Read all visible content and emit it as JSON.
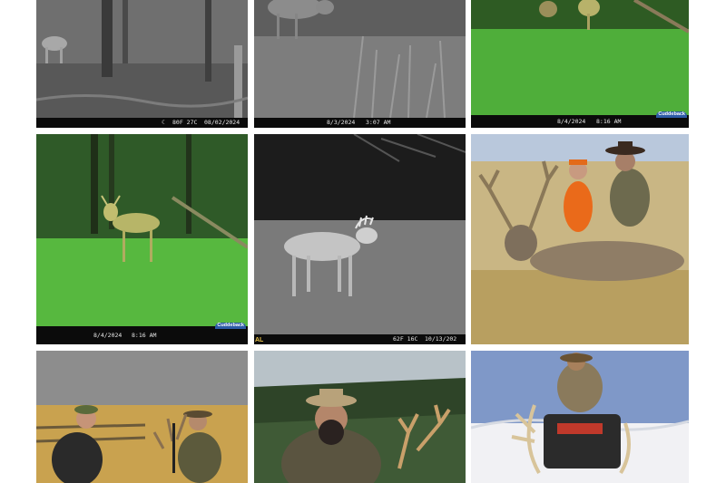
{
  "grid": {
    "tiles": [
      {
        "kind": "trail-cam-night",
        "caption": {
          "temp": "80F 27C",
          "date": "08/02/2024"
        }
      },
      {
        "kind": "trail-cam-night",
        "caption": {
          "date": "8/3/2024",
          "time": "3:07 AM"
        }
      },
      {
        "kind": "trail-cam-day",
        "caption": {
          "date": "8/4/2024",
          "time": "8:16 AM"
        },
        "logo": "Cuddeback"
      },
      {
        "kind": "trail-cam-day",
        "caption": {
          "date": "8/4/2024",
          "time": "8:16 AM"
        },
        "logo": "Cuddeback"
      },
      {
        "kind": "trail-cam-night",
        "caption": {
          "temp": "62F 16C",
          "date": "10/13/202"
        },
        "brand": "AL"
      },
      {
        "kind": "hunter-photo",
        "subject": "mule deer buck with two hunters"
      },
      {
        "kind": "hunter-photo",
        "subject": "hunter with elk antlers at fence"
      },
      {
        "kind": "hunter-photo",
        "subject": "bearded hunter with whitetail in forest"
      },
      {
        "kind": "hunter-photo",
        "subject": "hunter on ATV with antlers in snow"
      }
    ]
  }
}
